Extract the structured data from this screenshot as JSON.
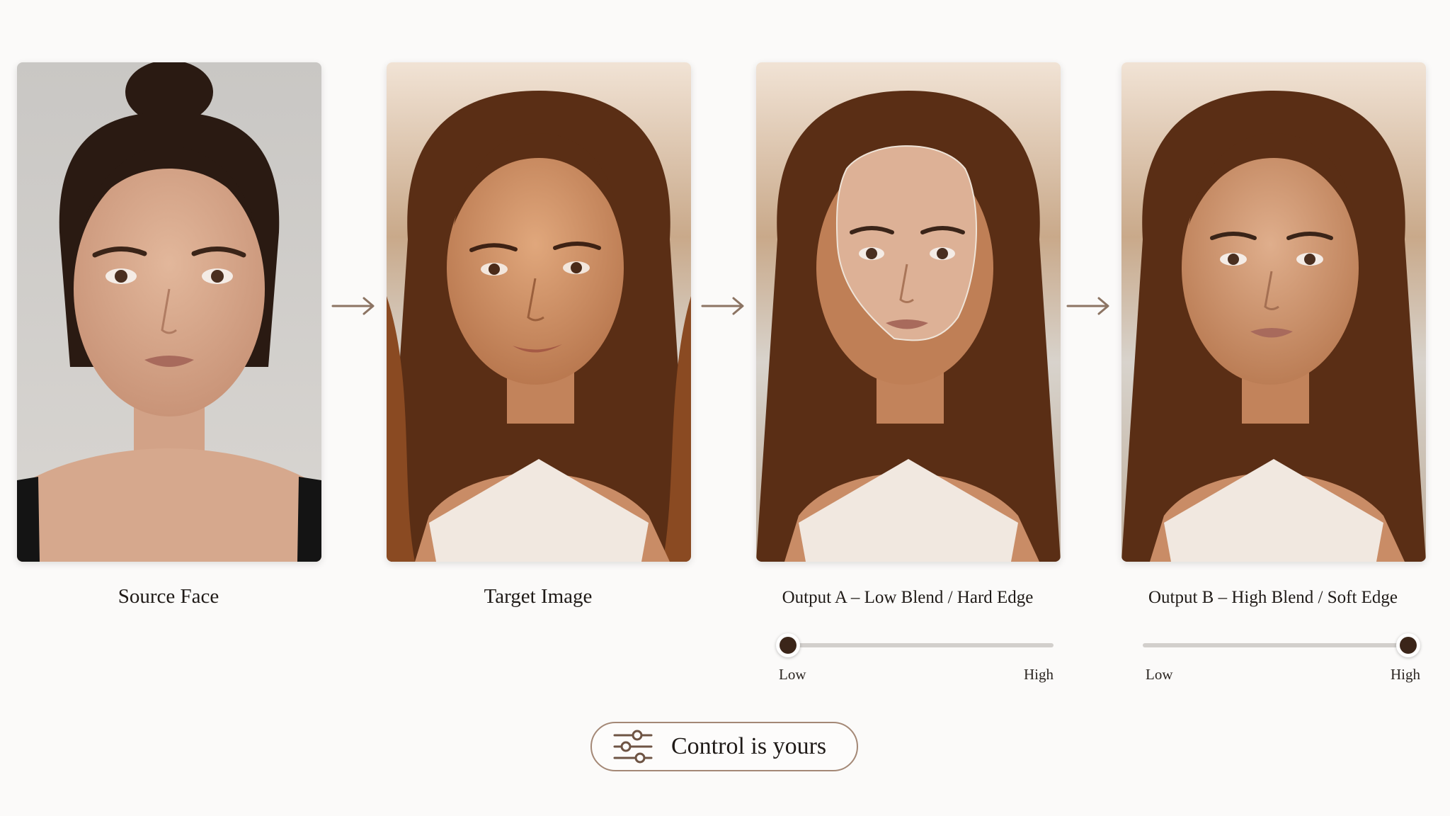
{
  "panels": [
    {
      "caption": "Source Face"
    },
    {
      "caption": "Target Image"
    },
    {
      "caption": "Output A – Low Blend / Hard Edge"
    },
    {
      "caption": "Output B – High Blend / Soft Edge"
    }
  ],
  "sliders": [
    {
      "low_label": "Low",
      "high_label": "High",
      "value": 0.0
    },
    {
      "low_label": "Low",
      "high_label": "High",
      "value": 1.0
    }
  ],
  "cta": {
    "label": "Control is yours",
    "icon": "sliders-icon"
  },
  "colors": {
    "accent": "#3b2519",
    "arrow": "#8c7463",
    "track": "#d2cfcc",
    "button_border": "#a48876"
  }
}
